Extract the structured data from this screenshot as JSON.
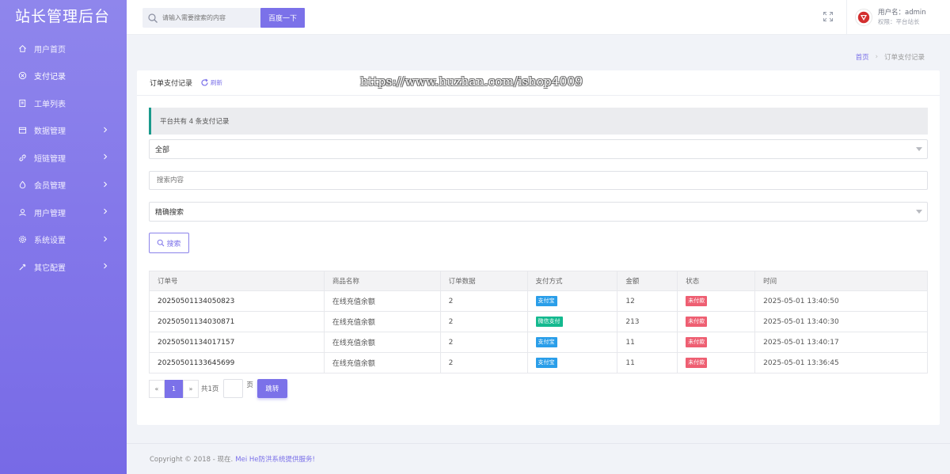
{
  "brand": "站长管理后台",
  "sidebar": {
    "items": [
      {
        "label": "用户首页",
        "icon": "home-icon"
      },
      {
        "label": "支付记录",
        "icon": "payment-icon"
      },
      {
        "label": "工单列表",
        "icon": "ticket-icon"
      },
      {
        "label": "数据管理",
        "icon": "data-icon"
      },
      {
        "label": "短链管理",
        "icon": "link-icon"
      },
      {
        "label": "会员管理",
        "icon": "member-icon"
      },
      {
        "label": "用户管理",
        "icon": "user-icon"
      },
      {
        "label": "系统设置",
        "icon": "settings-icon"
      },
      {
        "label": "其它配置",
        "icon": "config-icon"
      }
    ]
  },
  "header": {
    "search_placeholder": "请输入需要搜索的内容",
    "search_button": "百度一下",
    "user_name": "用户名：admin",
    "user_role": "权限：平台站长"
  },
  "breadcrumb": {
    "home": "首页",
    "sep": "›",
    "current": "订单支付记录"
  },
  "card": {
    "title": "订单支付记录",
    "refresh": "刷新",
    "watermark": "https://www.huzhan.com/ishop4009",
    "alert": "平台共有 4 条支付记录",
    "filter_select": "全部",
    "search_input_placeholder": "搜索内容",
    "mode_select": "精确搜索",
    "search_button": "搜索"
  },
  "table": {
    "headers": [
      "订单号",
      "商品名称",
      "订单数据",
      "支付方式",
      "金额",
      "状态",
      "时间"
    ],
    "rows": [
      {
        "order_no": "20250501134050823",
        "product": "在线充值余额",
        "qty": "2",
        "pay": "支付宝",
        "pay_color": "#2a9ee9",
        "amount": "12",
        "status": "未付款",
        "time": "2025-05-01 13:40:50"
      },
      {
        "order_no": "20250501134030871",
        "product": "在线充值余额",
        "qty": "2",
        "pay": "微信支付",
        "pay_color": "#14b98f",
        "amount": "213",
        "status": "未付款",
        "time": "2025-05-01 13:40:30"
      },
      {
        "order_no": "20250501134017157",
        "product": "在线充值余额",
        "qty": "2",
        "pay": "支付宝",
        "pay_color": "#2a9ee9",
        "amount": "11",
        "status": "未付款",
        "time": "2025-05-01 13:40:17"
      },
      {
        "order_no": "20250501133645699",
        "product": "在线充值余额",
        "qty": "2",
        "pay": "支付宝",
        "pay_color": "#2a9ee9",
        "amount": "11",
        "status": "未付款",
        "time": "2025-05-01 13:36:45"
      }
    ]
  },
  "pager": {
    "prev": "«",
    "current": "1",
    "next": "»",
    "total": "共1页",
    "unit": "页",
    "go": "跳转"
  },
  "footer": {
    "text": "Copyright © 2018 - 现在.",
    "link": "Mei He防洪系统提供服务!"
  },
  "colors": {
    "accent": "#7b71e9",
    "alipay": "#2a9ee9",
    "wechat": "#14b98f",
    "unpaid": "#ee5f72"
  }
}
